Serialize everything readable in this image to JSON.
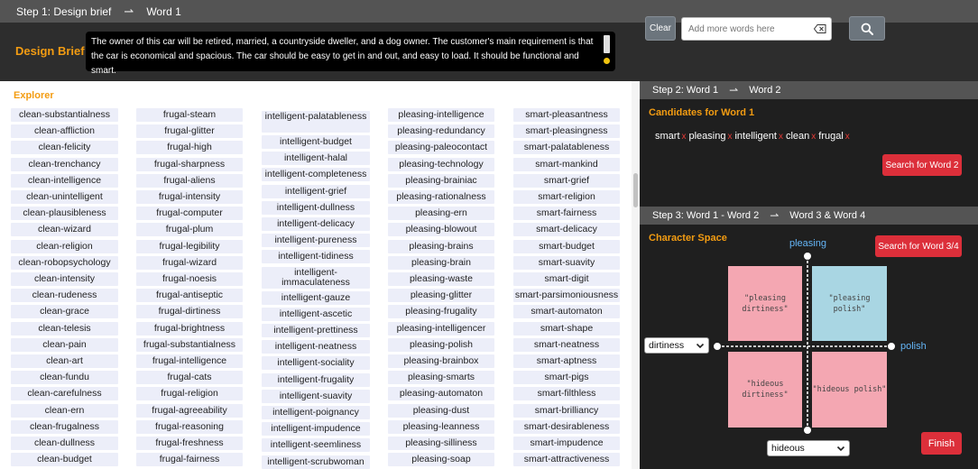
{
  "step1": {
    "label": "Step 1: Design brief",
    "target": "Word 1"
  },
  "brief": {
    "label": "Design Brief",
    "text": "The owner of this car will be retired, married, a countryside dweller, and a dog owner. The customer's main requirement is that the car is economical and spacious. The car should be easy to get in and out, and easy to load. It should be functional and smart.",
    "clear_label": "Clear",
    "input_placeholder": "Add more words here"
  },
  "explorer": {
    "title": "Explorer",
    "columns": [
      [
        "clean-substantialness",
        "clean-affliction",
        "clean-felicity",
        "clean-trenchancy",
        "clean-intelligence",
        "clean-unintelligent",
        "clean-plausibleness",
        "clean-wizard",
        "clean-religion",
        "clean-robopsychology",
        "clean-intensity",
        "clean-rudeness",
        "clean-grace",
        "clean-telesis",
        "clean-pain",
        "clean-art",
        "clean-fundu",
        "clean-carefulness",
        "clean-ern",
        "clean-frugalness",
        "clean-dullness",
        "clean-budget"
      ],
      [
        "frugal-steam",
        "frugal-glitter",
        "frugal-high",
        "frugal-sharpness",
        "frugal-aliens",
        "frugal-intensity",
        "frugal-computer",
        "frugal-plum",
        "frugal-legibility",
        "frugal-wizard",
        "frugal-noesis",
        "frugal-antiseptic",
        "frugal-dirtiness",
        "frugal-brightness",
        "frugal-substantialness",
        "frugal-intelligence",
        "frugal-cats",
        "frugal-religion",
        "frugal-agreeability",
        "frugal-reasoning",
        "frugal-freshness",
        "frugal-fairness"
      ],
      [
        "intelligent-palatableness",
        "intelligent-budget",
        "intelligent-halal",
        "intelligent-completeness",
        "intelligent-grief",
        "intelligent-dullness",
        "intelligent-delicacy",
        "intelligent-pureness",
        "intelligent-tidiness",
        "intelligent-immaculateness",
        "intelligent-gauze",
        "intelligent-ascetic",
        "intelligent-prettiness",
        "intelligent-neatness",
        "intelligent-sociality",
        "intelligent-frugality",
        "intelligent-suavity",
        "intelligent-poignancy",
        "intelligent-impudence",
        "intelligent-seemliness",
        "intelligent-scrubwoman"
      ],
      [
        "pleasing-intelligence",
        "pleasing-redundancy",
        "pleasing-paleocontact",
        "pleasing-technology",
        "pleasing-brainiac",
        "pleasing-rationalness",
        "pleasing-ern",
        "pleasing-blowout",
        "pleasing-brains",
        "pleasing-brain",
        "pleasing-waste",
        "pleasing-glitter",
        "pleasing-frugality",
        "pleasing-intelligencer",
        "pleasing-polish",
        "pleasing-brainbox",
        "pleasing-smarts",
        "pleasing-automaton",
        "pleasing-dust",
        "pleasing-leanness",
        "pleasing-silliness",
        "pleasing-soap"
      ],
      [
        "smart-pleasantness",
        "smart-pleasingness",
        "smart-palatableness",
        "smart-mankind",
        "smart-grief",
        "smart-religion",
        "smart-fairness",
        "smart-delicacy",
        "smart-budget",
        "smart-suavity",
        "smart-digit",
        "smart-parsimoniousness",
        "smart-automaton",
        "smart-shape",
        "smart-neatness",
        "smart-aptness",
        "smart-pigs",
        "smart-filthless",
        "smart-brilliancy",
        "smart-desirableness",
        "smart-impudence",
        "smart-attractiveness"
      ]
    ]
  },
  "step2": {
    "label": "Step 2: Word 1",
    "target": "Word 2",
    "candidates_title": "Candidates for Word 1",
    "candidates": [
      "smart",
      "pleasing",
      "intelligent",
      "clean",
      "frugal"
    ],
    "remove_mark": "x",
    "search_label": "Search for Word 2"
  },
  "step3": {
    "label": "Step 3: Word 1 - Word 2",
    "target": "Word 3 & Word 4",
    "title": "Character Space",
    "search_label": "Search for Word 3/4",
    "axis_top": "pleasing",
    "axis_right": "polish",
    "left_select": "dirtiness",
    "bottom_select": "hideous",
    "quadrants": {
      "top_left": "\"pleasing dirtiness\"",
      "top_right": "\"pleasing polish\"",
      "bottom_left": "\"hideous dirtiness\"",
      "bottom_right": "\"hideous polish\""
    },
    "finish_label": "Finish"
  },
  "colors": {
    "accent": "#f39c12",
    "danger": "#dc2f3a",
    "pink": "#f4a7b2",
    "blue": "#a9d6e3",
    "chip": "#eceef9"
  }
}
